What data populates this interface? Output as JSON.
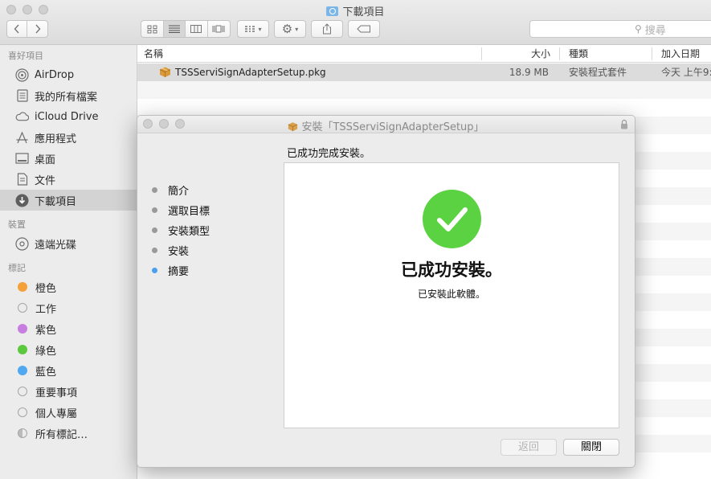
{
  "finder": {
    "title": "下載項目",
    "search_placeholder": "搜尋",
    "columns": {
      "name": "名稱",
      "size": "大小",
      "kind": "種類",
      "date_added": "加入日期"
    },
    "files": [
      {
        "name": "TSSServiSignAdapterSetup.pkg",
        "size": "18.9 MB",
        "kind": "安裝程式套件",
        "date_added": "今天 上午9:"
      }
    ]
  },
  "sidebar": {
    "favorites_label": "喜好項目",
    "favorites": [
      {
        "label": "AirDrop",
        "icon": "airdrop-icon"
      },
      {
        "label": "我的所有檔案",
        "icon": "all-files-icon"
      },
      {
        "label": "iCloud Drive",
        "icon": "cloud-icon"
      },
      {
        "label": "應用程式",
        "icon": "applications-icon"
      },
      {
        "label": "桌面",
        "icon": "desktop-icon"
      },
      {
        "label": "文件",
        "icon": "documents-icon"
      },
      {
        "label": "下載項目",
        "icon": "downloads-icon",
        "selected": true
      }
    ],
    "devices_label": "裝置",
    "devices": [
      {
        "label": "遠端光碟",
        "icon": "disc-icon"
      }
    ],
    "tags_label": "標記",
    "tags": [
      {
        "label": "橙色",
        "color": "#f5a13a"
      },
      {
        "label": "工作",
        "color": ""
      },
      {
        "label": "紫色",
        "color": "#c77ee0"
      },
      {
        "label": "綠色",
        "color": "#5ac93e"
      },
      {
        "label": "藍色",
        "color": "#4fa8f0"
      },
      {
        "label": "重要事項",
        "color": ""
      },
      {
        "label": "個人專屬",
        "color": ""
      },
      {
        "label": "所有標記…",
        "color": ""
      }
    ]
  },
  "installer": {
    "title": "安裝「TSSServiSignAdapterSetup」",
    "heading": "已成功完成安裝。",
    "steps": [
      {
        "label": "簡介",
        "current": false
      },
      {
        "label": "選取目標",
        "current": false
      },
      {
        "label": "安裝類型",
        "current": false
      },
      {
        "label": "安裝",
        "current": false
      },
      {
        "label": "摘要",
        "current": true
      }
    ],
    "success_title": "已成功安裝。",
    "success_subtitle": "已安裝此軟體。",
    "back_button": "返回",
    "close_button": "關閉",
    "check_color": "#5bd241",
    "current_step_color": "#4a9ff0"
  }
}
